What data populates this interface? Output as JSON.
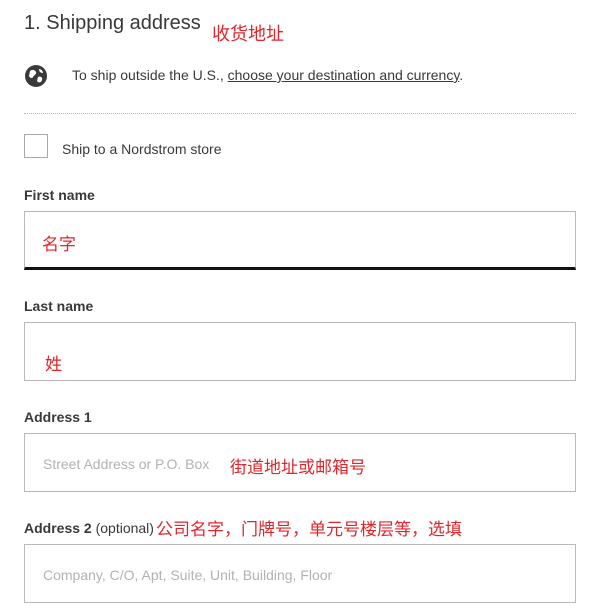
{
  "section": {
    "title": "1. Shipping address",
    "annotation": "收货地址"
  },
  "shipping_notice": {
    "icon": "globe-icon",
    "text": "To ship outside the U.S., ",
    "link": "choose your destination and currency",
    "end": "."
  },
  "store_option": {
    "checked": false,
    "label": "Ship to a Nordstrom store"
  },
  "first_name": {
    "label": "First name",
    "value": "名字"
  },
  "last_name": {
    "label": "Last name",
    "value": "姓"
  },
  "address1": {
    "label": "Address 1",
    "placeholder": "Street Address or P.O. Box",
    "annotation": "街道地址或邮箱号"
  },
  "address2": {
    "label": "Address 2",
    "optional": "(optional)",
    "annotation": "公司名字，门牌号，单元号楼层等，选填",
    "placeholder": "Company, C/O, Apt, Suite, Unit, Building, Floor"
  },
  "colors": {
    "annotation_red": "#e0262b",
    "text": "#393939",
    "placeholder": "#b2b2b2",
    "focus_border": "#111111"
  }
}
